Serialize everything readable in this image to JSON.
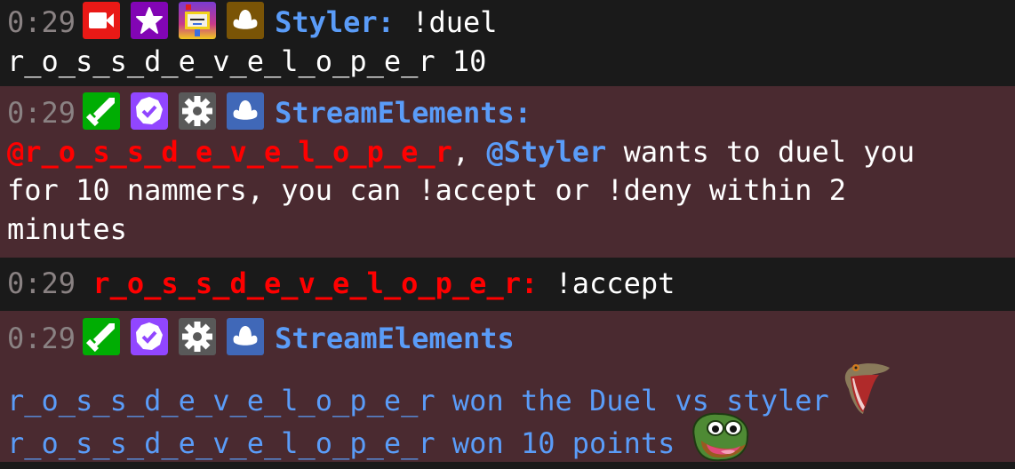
{
  "colors": {
    "background_dark": "#1a1a1a",
    "background_highlight": "#4a2a30",
    "timestamp": "#8a8283",
    "mention_blue": "#5a9cf8",
    "mention_red": "#ff0000",
    "text": "#ffffff"
  },
  "messages": [
    {
      "timestamp": "0:29",
      "badges": [
        "broadcaster-icon",
        "star-subscriber-icon",
        "pixel-character-icon",
        "bits-crown-icon"
      ],
      "username": "Styler",
      "separator": ":",
      "text_line1": "!duel",
      "text_line2": "r_o_s_s_d_e_v_e_l_o_p_e_r 10"
    },
    {
      "timestamp": "0:29",
      "badges": [
        "sword-moderator-icon",
        "verified-check-icon",
        "gear-icon",
        "bot-cloud-icon"
      ],
      "username": "StreamElements",
      "separator": ":",
      "mention1": "@r_o_s_s_d_e_v_e_l_o_p_e_r",
      "comma": ",",
      "mention2": "@Styler",
      "text_after": " wants to duel you",
      "text_line2": "for 10 nammers, you can !accept or !deny within 2",
      "text_line3": "minutes"
    },
    {
      "timestamp": "0:29",
      "username": "r_o_s_s_d_e_v_e_l_o_p_e_r",
      "separator": ":",
      "text": "!accept"
    },
    {
      "timestamp": "0:29",
      "badges": [
        "sword-moderator-icon",
        "verified-check-icon",
        "gear-icon",
        "bot-cloud-icon"
      ],
      "username": "StreamElements",
      "line1": "r_o_s_s_d_e_v_e_l_o_p_e_r won the Duel vs styler",
      "line1_emote": "lizard-screaming-emote",
      "line2": "r_o_s_s_d_e_v_e_l_o_p_e_r won 10 points",
      "line2_emote": "pepe-laughing-emote"
    }
  ]
}
